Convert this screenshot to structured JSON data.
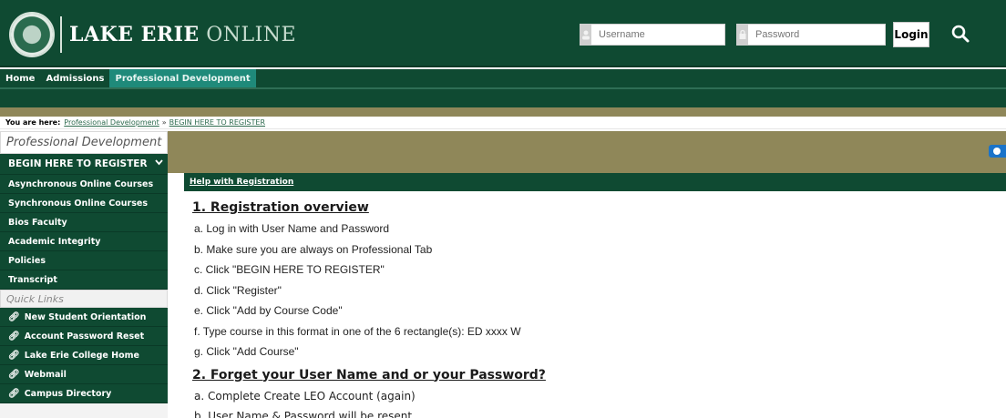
{
  "header": {
    "logo_strong": "LAKE ERIE",
    "logo_light": " ONLINE",
    "username_placeholder": "Username",
    "password_placeholder": "Password",
    "login_label": "Login"
  },
  "nav": {
    "items": [
      {
        "label": "Home"
      },
      {
        "label": "Admissions"
      },
      {
        "label": "Professional Development",
        "active": true
      }
    ]
  },
  "breadcrumb": {
    "label": "You are here:",
    "crumbs": [
      "Professional Development",
      "BEGIN HERE TO REGISTER"
    ],
    "separator": "»"
  },
  "sidebar": {
    "heading": "Professional Development",
    "items": [
      {
        "label": "BEGIN HERE TO REGISTER"
      },
      {
        "label": "Asynchronous Online Courses"
      },
      {
        "label": "Synchronous Online Courses"
      },
      {
        "label": "Bios Faculty"
      },
      {
        "label": "Academic Integrity"
      },
      {
        "label": "Policies"
      },
      {
        "label": "Transcript"
      }
    ],
    "quick_links_heading": "Quick Links",
    "quick_links": [
      {
        "label": "New Student Orientation"
      },
      {
        "label": "Account Password Reset"
      },
      {
        "label": "Lake Erie College Home"
      },
      {
        "label": "Webmail"
      },
      {
        "label": "Campus Directory"
      }
    ]
  },
  "content": {
    "header_link": "Help with Registration",
    "section1_title": "1. Registration overview",
    "steps1": [
      "a. Log in with User Name and Password",
      "b. Make sure you are always on Professional Tab",
      "c. Click \"BEGIN HERE TO REGISTER\"",
      "d. Click \"Register\"",
      "e. Click \"Add by Course Code\"",
      "f. Type course in this format in one of the 6 rectangle(s): ED xxxx W",
      "g. Click \"Add Course\""
    ],
    "section2_title": "2. Forget your User Name and or your Password?",
    "steps2": [
      "a. Complete Create LEO Account (again)",
      "b. User Name & Password will be resent"
    ]
  },
  "colors": {
    "brand_green": "#0f4a32",
    "tan": "#8f8759",
    "active_tab": "#1f8a7a",
    "accent_blue": "#1a73c9"
  }
}
